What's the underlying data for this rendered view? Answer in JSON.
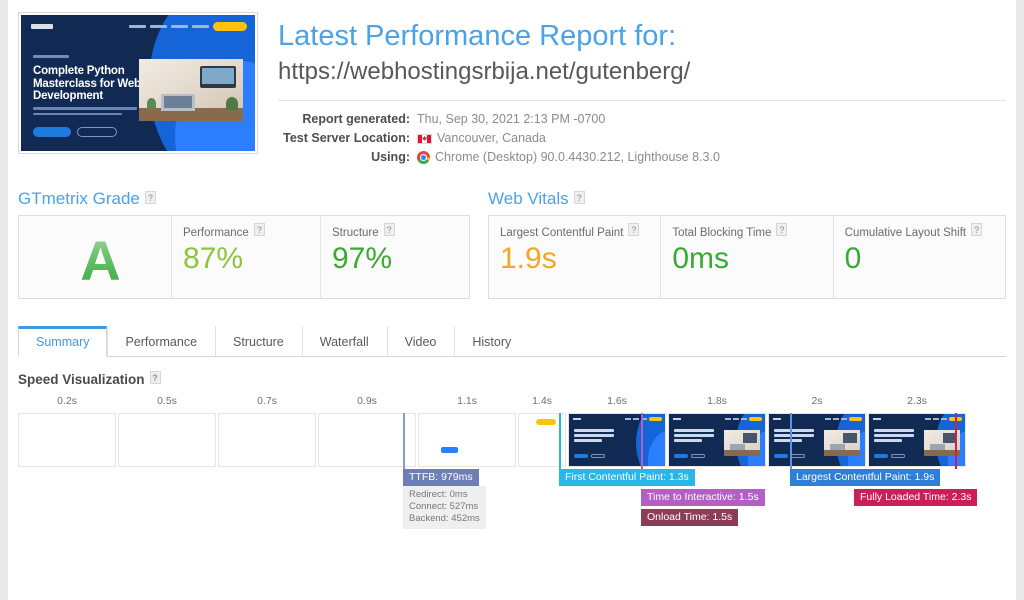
{
  "header": {
    "title": "Latest Performance Report for:",
    "url": "https://webhostingsrbija.net/gutenberg/",
    "thumbnail": {
      "headline": "Complete Python Masterclass for Web Development",
      "alt": "site-screenshot"
    },
    "meta": [
      {
        "label": "Report generated:",
        "value": "Thu, Sep 30, 2021 2:13 PM -0700",
        "icon": ""
      },
      {
        "label": "Test Server Location:",
        "value": "Vancouver, Canada",
        "icon": "canada-flag-icon"
      },
      {
        "label": "Using:",
        "value": "Chrome (Desktop) 90.0.4430.212, Lighthouse 8.3.0",
        "icon": "chrome-icon"
      }
    ]
  },
  "help_glyph": "?",
  "gtmetrix_grade": {
    "section_title": "GTmetrix Grade",
    "grade": "A",
    "metrics": [
      {
        "label": "Performance",
        "value": "87%",
        "color": "#8cc63e"
      },
      {
        "label": "Structure",
        "value": "97%",
        "color": "#3aaa35"
      }
    ]
  },
  "web_vitals": {
    "section_title": "Web Vitals",
    "metrics": [
      {
        "label": "Largest Contentful Paint",
        "value": "1.9s",
        "color": "#f5a623"
      },
      {
        "label": "Total Blocking Time",
        "value": "0ms",
        "color": "#3aaa35"
      },
      {
        "label": "Cumulative Layout Shift",
        "value": "0",
        "color": "#3aaa35"
      }
    ]
  },
  "tabs": [
    {
      "label": "Summary",
      "active": true
    },
    {
      "label": "Performance",
      "active": false
    },
    {
      "label": "Structure",
      "active": false
    },
    {
      "label": "Waterfall",
      "active": false
    },
    {
      "label": "Video",
      "active": false
    },
    {
      "label": "History",
      "active": false
    }
  ],
  "speed_visualization": {
    "title": "Speed Visualization",
    "ticks": [
      "0.2s",
      "0.5s",
      "0.7s",
      "0.9s",
      "1.1s",
      "1.4s",
      "1.6s",
      "1.8s",
      "2s",
      "2.3s"
    ],
    "frames": [
      {
        "state": "blank"
      },
      {
        "state": "blank"
      },
      {
        "state": "blank"
      },
      {
        "state": "blank"
      },
      {
        "state": "partial"
      },
      {
        "state": "partial-cta"
      },
      {
        "state": "hero"
      },
      {
        "state": "hero-photo"
      },
      {
        "state": "hero-photo"
      },
      {
        "state": "hero-photo"
      }
    ],
    "markers": [
      {
        "name": "ttfb",
        "label": "TTFB: 979ms",
        "color": "#6d7fb5",
        "line_color": "#8e9bc6"
      },
      {
        "name": "first-contentful-paint",
        "label": "First Contentful Paint: 1.3s",
        "color": "#29b6e8",
        "line_color": "#29b6e8"
      },
      {
        "name": "time-to-interactive",
        "label": "Time to Interactive: 1.5s",
        "color": "#b45fc4",
        "line_color": "#b45fc4"
      },
      {
        "name": "onload-time",
        "label": "Onload Time: 1.5s",
        "color": "#8e3b57",
        "line_color": "#8e3b57"
      },
      {
        "name": "largest-contentful-paint",
        "label": "Largest Contentful Paint: 1.9s",
        "color": "#2f7ed8",
        "line_color": "#5b94e0"
      },
      {
        "name": "fully-loaded-time",
        "label": "Fully Loaded Time: 2.3s",
        "color": "#c9205a",
        "line_color": "#c9205a"
      }
    ],
    "ttfb_details": {
      "redirect": "Redirect: 0ms",
      "connect": "Connect: 527ms",
      "backend": "Backend: 452ms"
    }
  }
}
